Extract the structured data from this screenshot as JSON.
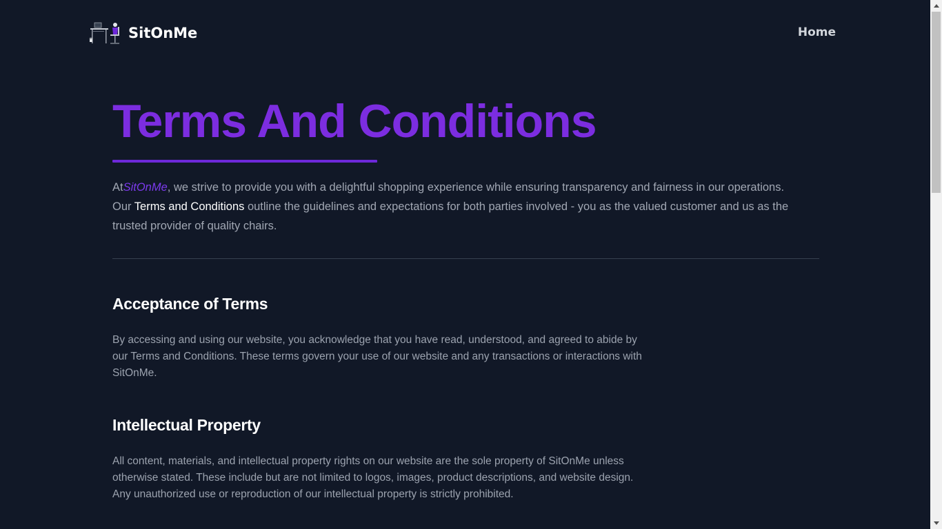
{
  "header": {
    "brand_name": "SitOnMe",
    "nav_home": "Home"
  },
  "main": {
    "title": "Terms And Conditions",
    "intro": {
      "prefix": "At",
      "brand": "SitOnMe",
      "part1": ", we strive to provide you with a delightful shopping experience while ensuring transparency and fairness in our operations. Our ",
      "highlight": "Terms and Conditions",
      "part2": " outline the guidelines and expectations for both parties involved - you as the valued customer and us as the trusted provider of quality chairs."
    },
    "sections": [
      {
        "heading": "Acceptance of Terms",
        "body": "By accessing and using our website, you acknowledge that you have read, understood, and agreed to abide by our Terms and Conditions. These terms govern your use of our website and any transactions or interactions with SitOnMe."
      },
      {
        "heading": "Intellectual Property",
        "body": "All content, materials, and intellectual property rights on our website are the sole property of SitOnMe unless otherwise stated. These include but are not limited to logos, images, product descriptions, and website design. Any unauthorized use or reproduction of our intellectual property is strictly prohibited."
      }
    ]
  },
  "colors": {
    "background": "#111827",
    "accent": "#7c2de0",
    "heading": "#ffffff",
    "body_text": "#9ca3af"
  },
  "icons": {
    "logo": "chair-desk-logo-icon",
    "scroll_up": "scroll-up-arrow-icon",
    "scroll_down": "scroll-down-arrow-icon"
  }
}
